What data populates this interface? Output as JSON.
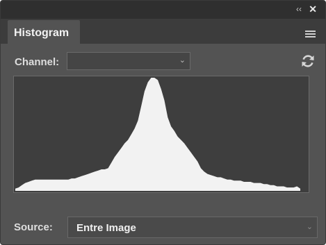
{
  "panel": {
    "collapse_glyph": "‹‹",
    "close_glyph": "✕",
    "tab_label": "Histogram",
    "menu_icon": "panel-menu-icon"
  },
  "channel": {
    "label": "Channel:",
    "value": "",
    "refresh_icon": "refresh-icon"
  },
  "source": {
    "label": "Source:",
    "value": "Entre Image"
  },
  "histogram": {
    "fill_color": "#f2f2f2",
    "background_color": "#3e3e3e",
    "levels": [
      0.02,
      0.03,
      0.05,
      0.07,
      0.08,
      0.09,
      0.1,
      0.1,
      0.1,
      0.1,
      0.1,
      0.1,
      0.1,
      0.1,
      0.1,
      0.1,
      0.1,
      0.11,
      0.11,
      0.12,
      0.13,
      0.14,
      0.15,
      0.16,
      0.17,
      0.18,
      0.19,
      0.19,
      0.2,
      0.25,
      0.3,
      0.34,
      0.38,
      0.42,
      0.45,
      0.5,
      0.55,
      0.62,
      0.75,
      0.88,
      0.96,
      1.0,
      1.0,
      0.98,
      0.9,
      0.8,
      0.65,
      0.57,
      0.53,
      0.48,
      0.45,
      0.42,
      0.38,
      0.34,
      0.3,
      0.26,
      0.2,
      0.17,
      0.15,
      0.14,
      0.13,
      0.12,
      0.12,
      0.11,
      0.1,
      0.1,
      0.09,
      0.09,
      0.09,
      0.08,
      0.08,
      0.08,
      0.07,
      0.07,
      0.07,
      0.06,
      0.06,
      0.05,
      0.05,
      0.04,
      0.04,
      0.04,
      0.03,
      0.03,
      0.03,
      0.04,
      0.02
    ]
  }
}
